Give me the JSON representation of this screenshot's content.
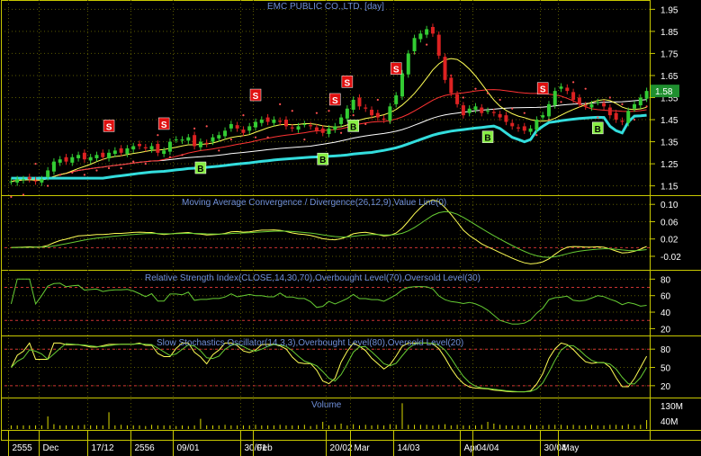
{
  "main_title": "EMC PUBLIC CO.,LTD. [day]",
  "price_marker": "1.58",
  "colors": {
    "background": "#000000",
    "frame": "#c8c800",
    "grid": "#5a5a00",
    "label_blue": "#6f8fd8",
    "axis_text": "#ffffff",
    "candle_up": "#33cc33",
    "candle_down": "#dd2222",
    "signal_fill_sell": "#e01010",
    "signal_fill_buy": "#88ee44",
    "trend_line": "#33dddd",
    "sar_dots": "#ff5050",
    "macd_line": "#ffff55",
    "signal_line": "#66cc33"
  },
  "chart_data": [
    {
      "type": "candlestick",
      "title": "EMC PUBLIC CO.,LTD. [day]",
      "ylim": [
        1.12,
        1.98
      ],
      "yticks": [
        1.95,
        1.85,
        1.75,
        1.65,
        1.55,
        1.45,
        1.35,
        1.25,
        1.15
      ],
      "last_price": 1.58,
      "close": [
        1.17,
        1.18,
        1.18,
        1.18,
        1.17,
        1.18,
        1.22,
        1.26,
        1.27,
        1.26,
        1.28,
        1.29,
        1.27,
        1.28,
        1.29,
        1.28,
        1.3,
        1.31,
        1.3,
        1.32,
        1.33,
        1.33,
        1.32,
        1.33,
        1.3,
        1.31,
        1.35,
        1.36,
        1.36,
        1.37,
        1.33,
        1.35,
        1.34,
        1.37,
        1.38,
        1.4,
        1.43,
        1.41,
        1.39,
        1.42,
        1.44,
        1.45,
        1.44,
        1.45,
        1.44,
        1.42,
        1.41,
        1.42,
        1.43,
        1.42,
        1.4,
        1.39,
        1.41,
        1.42,
        1.46,
        1.5,
        1.54,
        1.51,
        1.5,
        1.47,
        1.46,
        1.45,
        1.51,
        1.56,
        1.66,
        1.75,
        1.82,
        1.84,
        1.86,
        1.84,
        1.74,
        1.63,
        1.57,
        1.52,
        1.47,
        1.5,
        1.51,
        1.48,
        1.49,
        1.48,
        1.46,
        1.44,
        1.42,
        1.41,
        1.4,
        1.41,
        1.45,
        1.47,
        1.52,
        1.58,
        1.6,
        1.58,
        1.54,
        1.52,
        1.51,
        1.52,
        1.53,
        1.51,
        1.47,
        1.45,
        1.44,
        1.49,
        1.52,
        1.55,
        1.58
      ],
      "signals": [
        {
          "type": "S",
          "index": 16
        },
        {
          "type": "S",
          "index": 25
        },
        {
          "type": "B",
          "index": 31
        },
        {
          "type": "S",
          "index": 40
        },
        {
          "type": "B",
          "index": 51
        },
        {
          "type": "S",
          "index": 53
        },
        {
          "type": "S",
          "index": 55
        },
        {
          "type": "B",
          "index": 56
        },
        {
          "type": "S",
          "index": 63
        },
        {
          "type": "B",
          "index": 78
        },
        {
          "type": "S",
          "index": 87
        },
        {
          "type": "B",
          "index": 96
        }
      ]
    },
    {
      "type": "line",
      "title": "Moving Average Convergence / Divergence(26,12,9),Value Line(0)",
      "ylim": [
        -0.045,
        0.115
      ],
      "yticks": [
        0.1,
        0.06,
        0.02,
        -0.02
      ],
      "reference_lines": [
        0
      ]
    },
    {
      "type": "line",
      "title": "Relative Strength Index(CLOSE,14,30,70),Overbought Level(70),Oversold Level(30)",
      "ylim": [
        15,
        88
      ],
      "yticks": [
        80,
        60,
        40,
        20
      ],
      "reference_lines": [
        70,
        30
      ]
    },
    {
      "type": "line",
      "title": "Slow Stochastics Oscillator(14,3,3),Overbought Level(80),Oversold Level(20)",
      "ylim": [
        5,
        98
      ],
      "yticks": [
        80,
        50,
        20
      ],
      "reference_lines": [
        80,
        20
      ]
    },
    {
      "type": "bar",
      "title": "Volume",
      "yticks": [
        "130M",
        "40M"
      ],
      "values": [
        3,
        3,
        3,
        3,
        3,
        3,
        18,
        5,
        3,
        3,
        3,
        3,
        4,
        3,
        3,
        3,
        25,
        3,
        4,
        3,
        3,
        3,
        2,
        4,
        3,
        3,
        3,
        2,
        3,
        2,
        3,
        14,
        3,
        3,
        3,
        4,
        3,
        3,
        3,
        3,
        4,
        3,
        3,
        3,
        4,
        3,
        3,
        3,
        4,
        2,
        4,
        9,
        3,
        4,
        6,
        3,
        5,
        3,
        4,
        3,
        4,
        3,
        5,
        4,
        40,
        4,
        4,
        4,
        4,
        3,
        4,
        5,
        3,
        4,
        3,
        3,
        3,
        4,
        9,
        6,
        4,
        3,
        3,
        3,
        3,
        4,
        3,
        3,
        4,
        4,
        4,
        3,
        4,
        3,
        3,
        4,
        3,
        3,
        4,
        4,
        3,
        5,
        3,
        4,
        12
      ]
    }
  ],
  "time_axis": {
    "labels": [
      "2555",
      "Dec",
      "17/12",
      "2556",
      "09/01",
      "30/01",
      "Feb",
      "20/02",
      "Mar",
      "14/03",
      "Apr",
      "04/04",
      "30/04",
      "May"
    ]
  }
}
